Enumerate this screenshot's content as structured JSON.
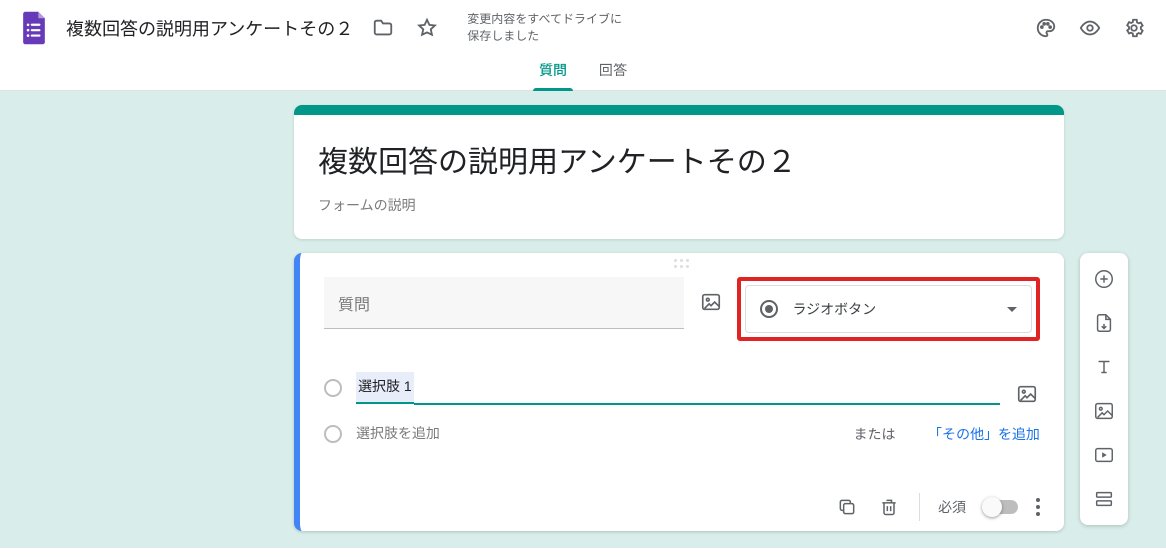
{
  "header": {
    "doc_title": "複数回答の説明用アンケートその２",
    "save_status_line1": "変更内容をすべてドライブに",
    "save_status_line2": "保存しました"
  },
  "tabs": {
    "questions": "質問",
    "responses": "回答"
  },
  "title_card": {
    "title": "複数回答の説明用アンケートその２",
    "description": "フォームの説明"
  },
  "question": {
    "placeholder": "質問",
    "type_label": "ラジオボタン",
    "option1": "選択肢 1",
    "add_option_placeholder": "選択肢を追加",
    "or_text": "または",
    "add_other": "「その他」を追加",
    "required_label": "必須"
  },
  "colors": {
    "theme": "#009688",
    "accent_blue": "#4285f4",
    "highlight_red": "#e02424"
  }
}
